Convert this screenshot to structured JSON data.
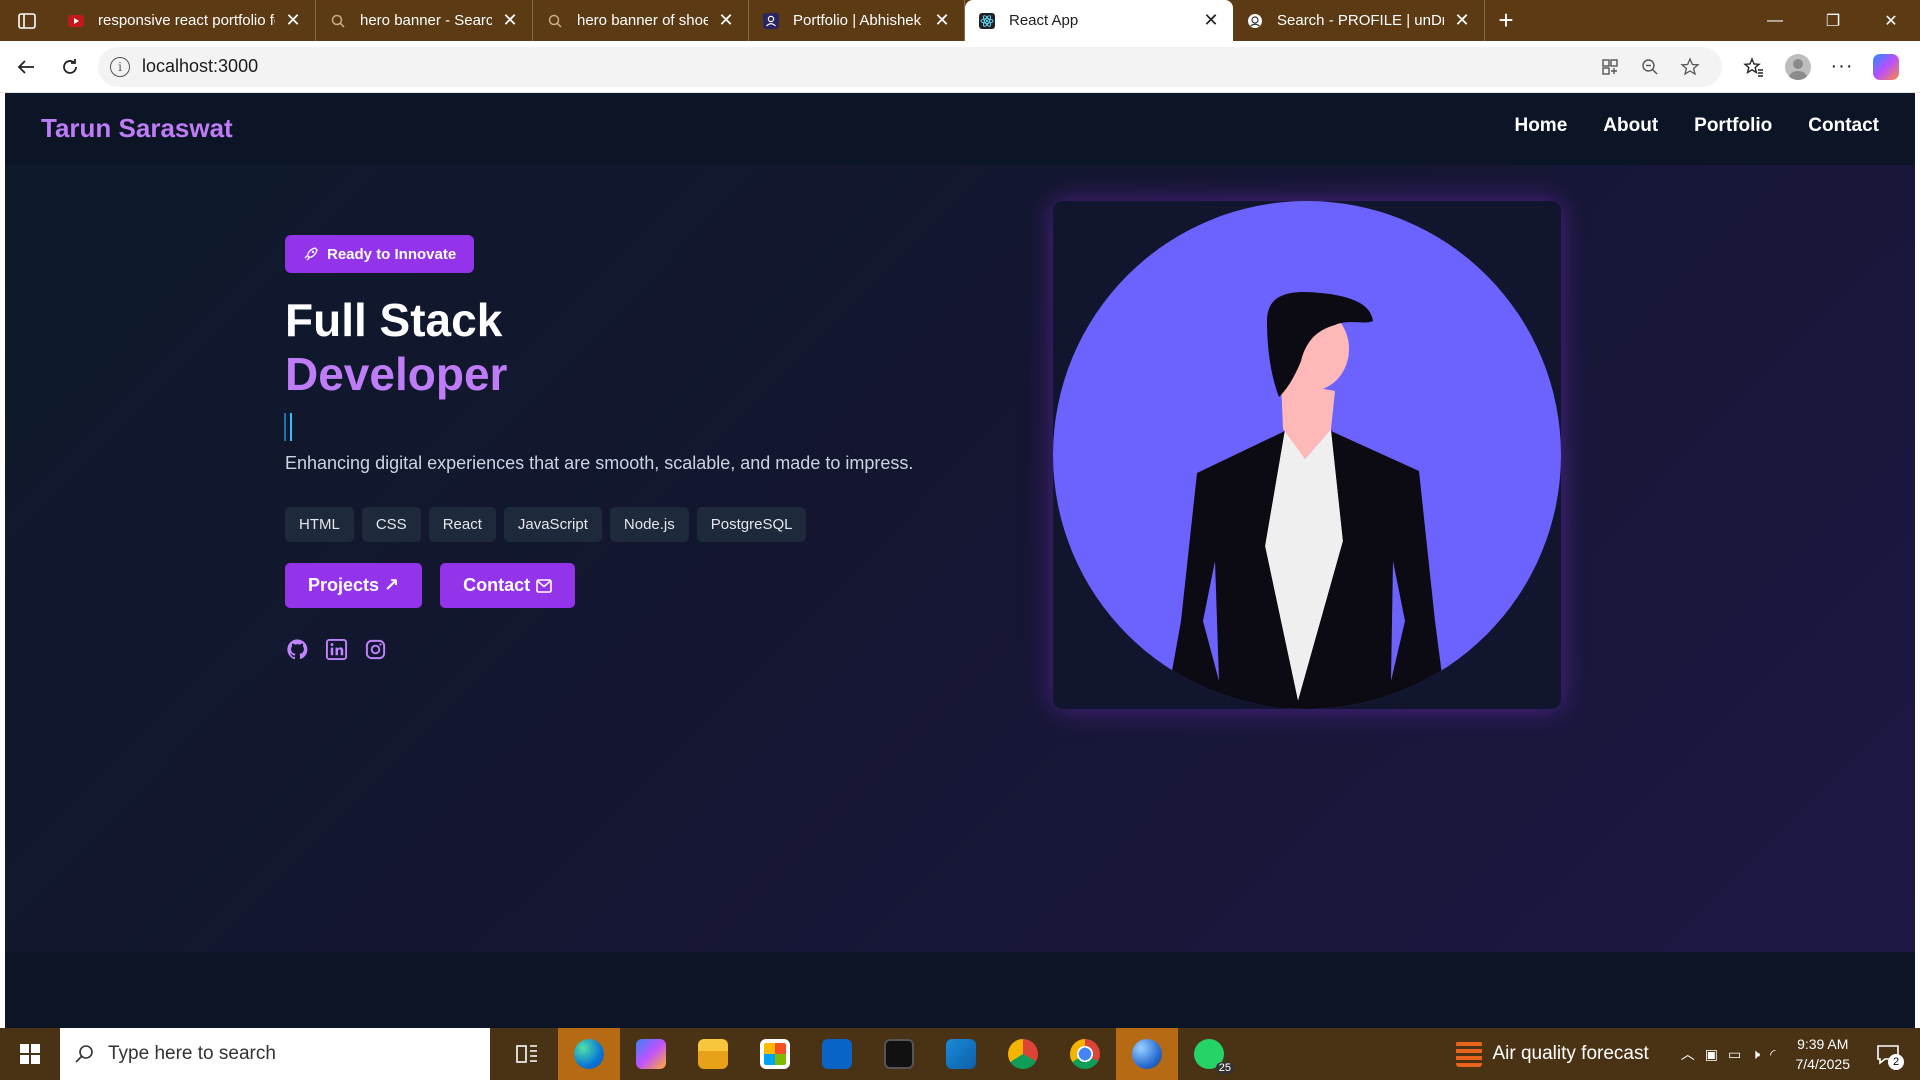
{
  "browser": {
    "tabs": [
      {
        "title": "responsive react portfolio fo",
        "icon": "youtube-icon"
      },
      {
        "title": "hero banner - Search",
        "icon": "search-icon"
      },
      {
        "title": "hero banner of shoes - Searc",
        "icon": "search-icon"
      },
      {
        "title": "Portfolio | Abhishek Ganvir",
        "icon": "profile-icon"
      },
      {
        "title": "React App",
        "icon": "react-icon",
        "active": true
      },
      {
        "title": "Search - PROFILE | unDraw",
        "icon": "undraw-icon"
      }
    ],
    "url": "localhost:3000"
  },
  "navbar": {
    "brand": "Tarun Saraswat",
    "links": [
      "Home",
      "About",
      "Portfolio",
      "Contact"
    ]
  },
  "hero": {
    "badge": "Ready to Innovate",
    "badge_icon": "rocket-icon",
    "title_line1": "Full Stack",
    "title_line2": "Developer",
    "tagline": "Enhancing digital experiences that are smooth, scalable, and made to impress.",
    "skills": [
      "HTML",
      "CSS",
      "React",
      "JavaScript",
      "Node.js",
      "PostgreSQL"
    ],
    "buttons": {
      "projects": "Projects ↗",
      "contact": "Contact"
    },
    "socials": [
      "github-icon",
      "linkedin-icon",
      "instagram-icon"
    ],
    "accent_color": "#9333ea",
    "title_accent": "#bf7cf7",
    "illustration_bg": "#6c63ff"
  },
  "taskbar": {
    "search_placeholder": "Type here to search",
    "weather": "Air quality forecast",
    "time": "9:39 AM",
    "date": "7/4/2025",
    "whatsapp_badge": "25",
    "notifications": "2"
  }
}
